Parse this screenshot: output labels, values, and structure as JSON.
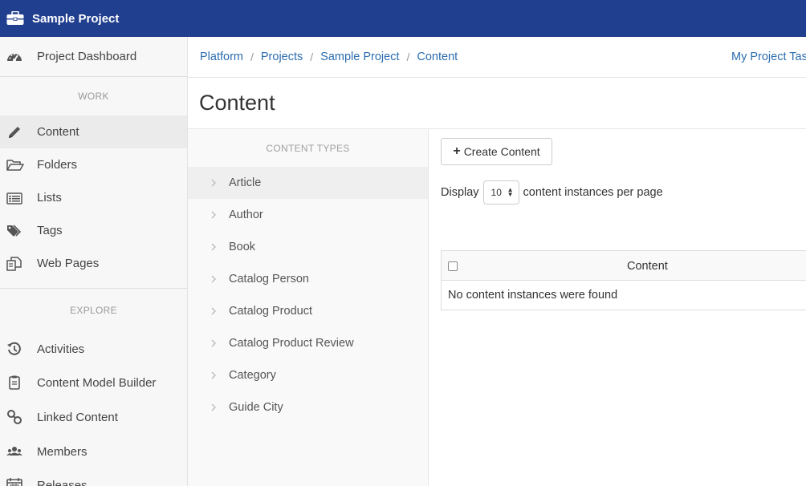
{
  "app": {
    "project_name": "Sample Project"
  },
  "sidebar": {
    "dashboard": {
      "label": "Project Dashboard",
      "icon": "dashboard-icon"
    },
    "work_heading": "WORK",
    "work_items": [
      {
        "label": "Content",
        "icon": "pencil-icon",
        "active": true
      },
      {
        "label": "Folders",
        "icon": "folder-open-icon"
      },
      {
        "label": "Lists",
        "icon": "list-icon"
      },
      {
        "label": "Tags",
        "icon": "tags-icon"
      },
      {
        "label": "Web Pages",
        "icon": "web-pages-icon"
      }
    ],
    "explore_heading": "EXPLORE",
    "explore_items": [
      {
        "label": "Activities",
        "icon": "history-icon"
      },
      {
        "label": "Content Model Builder",
        "icon": "clipboard-icon"
      },
      {
        "label": "Linked Content",
        "icon": "link-icon"
      },
      {
        "label": "Members",
        "icon": "members-icon"
      },
      {
        "label": "Releases",
        "icon": "calendar-icon"
      }
    ]
  },
  "breadcrumb": [
    "Platform",
    "Projects",
    "Sample Project",
    "Content"
  ],
  "header": {
    "tasks_link": "My Project Tasks"
  },
  "page": {
    "title": "Content"
  },
  "content_types": {
    "heading": "CONTENT TYPES",
    "items": [
      "Article",
      "Author",
      "Book",
      "Catalog Person",
      "Catalog Product",
      "Catalog Product Review",
      "Category",
      "Guide City"
    ],
    "selected": "Article"
  },
  "content_pane": {
    "create_button": "Create Content",
    "display_label": "Display",
    "page_size": "10",
    "per_page_label": "content instances per page",
    "table": {
      "columns": [
        "Content"
      ],
      "empty_message": "No content instances were found"
    }
  },
  "colors": {
    "topbar": "#213f8f",
    "link": "#2b6cb0"
  }
}
